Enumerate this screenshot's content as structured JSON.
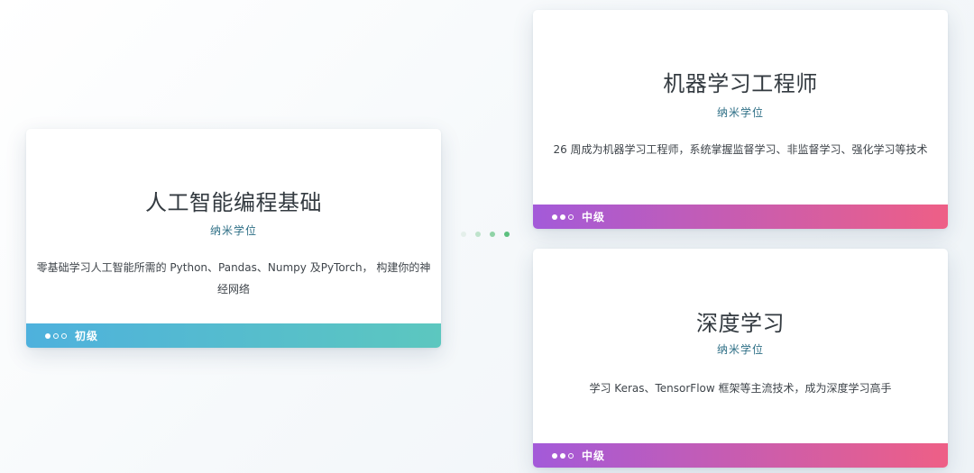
{
  "cards": {
    "basic": {
      "title": "人工智能编程基础",
      "subtitle": "纳米学位",
      "description": "零基础学习人工智能所需的 Python、Pandas、Numpy 及PyTorch， 构建你的神经网络",
      "level": "初级",
      "level_dots_filled": 1,
      "level_dots_total": 3,
      "footer_colors": [
        "#4eb1dd",
        "#5cc7bf"
      ]
    },
    "ml": {
      "title": "机器学习工程师",
      "subtitle": "纳米学位",
      "description": "26 周成为机器学习工程师，系统掌握监督学习、非监督学习、强化学习等技术",
      "level": "中级",
      "level_dots_filled": 2,
      "level_dots_total": 3,
      "footer_colors": [
        "#a35ad9",
        "#ee5f86"
      ]
    },
    "dl": {
      "title": "深度学习",
      "subtitle": "纳米学位",
      "description": "学习 Keras、TensorFlow 框架等主流技术，成为深度学习高手",
      "level": "中级",
      "level_dots_filled": 2,
      "level_dots_total": 3,
      "footer_colors": [
        "#a35ad9",
        "#ee5f86"
      ]
    }
  },
  "connector": {
    "dot_colors": [
      "#e4efea",
      "#bfe3cc",
      "#8fd3a6",
      "#5cc07e"
    ]
  }
}
